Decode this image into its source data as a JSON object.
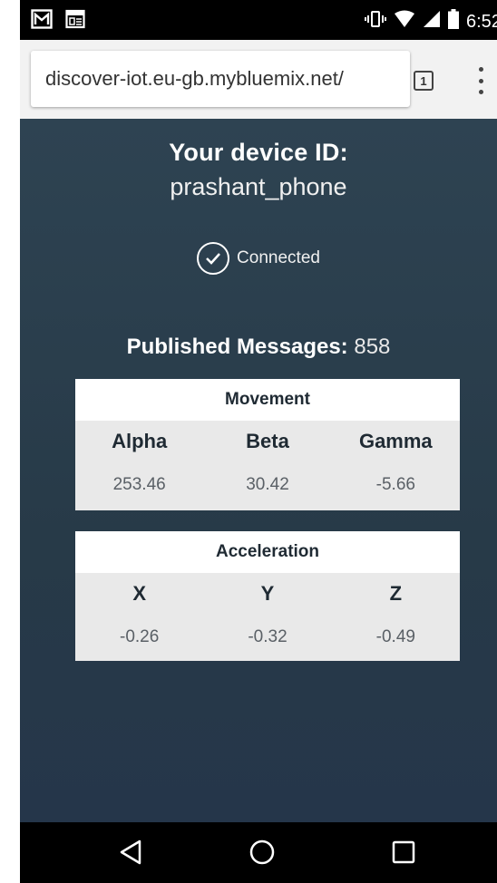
{
  "status_bar": {
    "time": "6:52",
    "icons": [
      "gmail-icon",
      "news-icon",
      "vibrate-icon",
      "wifi-icon",
      "signal-icon",
      "battery-icon"
    ]
  },
  "browser": {
    "url": "discover-iot.eu-gb.mybluemix.net/",
    "tab_count": "1",
    "menu_icon": "more-vert-icon"
  },
  "device": {
    "heading": "Your device ID:",
    "id": "prashant_phone",
    "status": "Connected",
    "status_icon": "check-circle-icon"
  },
  "published": {
    "label": "Published Messages:",
    "count": "858"
  },
  "movement": {
    "title": "Movement",
    "columns": [
      "Alpha",
      "Beta",
      "Gamma"
    ],
    "values": [
      "253.46",
      "30.42",
      "-5.66"
    ]
  },
  "acceleration": {
    "title": "Acceleration",
    "columns": [
      "X",
      "Y",
      "Z"
    ],
    "values": [
      "-0.26",
      "-0.32",
      "-0.49"
    ]
  },
  "nav": {
    "icons": [
      "back-icon",
      "home-icon",
      "recents-icon"
    ]
  },
  "colors": {
    "background": "#2b4050",
    "card": "#e9e9e9",
    "card_header": "#ffffff",
    "text_on_dark": "#ffffff"
  }
}
